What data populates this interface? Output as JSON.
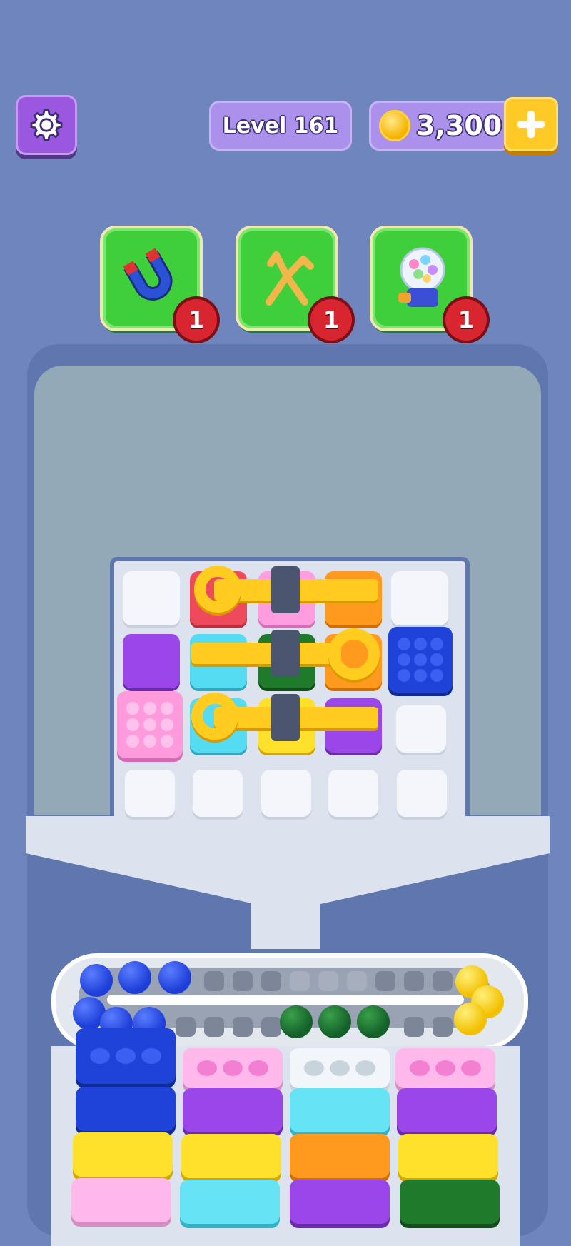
{
  "header": {
    "level_label": "Level 161",
    "coins": "3,300"
  },
  "icons": {
    "settings": "gear-icon",
    "add": "plus-icon",
    "coin": "coin-icon",
    "magnet": "magnet-icon",
    "rope": "rope-icon",
    "gumball": "gumball-machine-icon"
  },
  "boosters": [
    {
      "name": "magnet",
      "count": "1"
    },
    {
      "name": "rope",
      "count": "1"
    },
    {
      "name": "gumball",
      "count": "1"
    }
  ],
  "colors": {
    "background": "#6f85bd",
    "booster_green": "#3fcf3a",
    "pin_yellow": "#ffcc1f",
    "coin_gold": "#f5b400",
    "badge_red": "#d8252f"
  }
}
